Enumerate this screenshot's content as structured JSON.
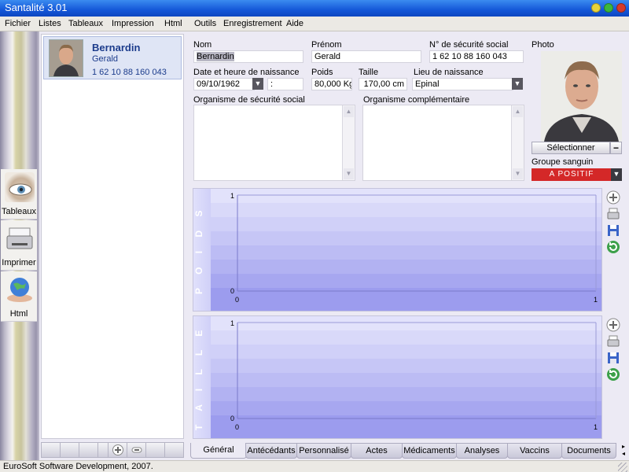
{
  "window": {
    "title": "Santalité 3.01"
  },
  "menu": [
    {
      "label": "Fichier"
    },
    {
      "label": "Listes"
    },
    {
      "label": "Tableaux"
    },
    {
      "label": "Impression"
    },
    {
      "label": "Html"
    },
    {
      "label": "Outils"
    },
    {
      "label": "Enregistrement"
    },
    {
      "label": "Aide"
    }
  ],
  "sidetools": {
    "tableaux": "Tableaux",
    "imprimer": "Imprimer",
    "html": "Html"
  },
  "patient_card": {
    "name": "Bernardin",
    "firstname": "Gerald",
    "ssn": "1 62 10 88 160 043"
  },
  "form": {
    "nom_label": "Nom",
    "nom_value": "Bernardin",
    "prenom_label": "Prénom",
    "prenom_value": "Gerald",
    "ssn_label": "N° de sécurité social",
    "ssn_value": "1 62 10 88 160 043",
    "photo_label": "Photo",
    "birth_label": "Date et heure de naissance",
    "birth_date": "09/10/1962",
    "birth_time": ":",
    "poids_label": "Poids",
    "poids_value": "80,000 Kg",
    "taille_label": "Taille",
    "taille_value": "170,00 cm",
    "lieu_label": "Lieu de naissance",
    "lieu_value": "Epinal",
    "org_secu_label": "Organisme de sécurité social",
    "org_comp_label": "Organisme complémentaire",
    "select_label": "Sélectionner",
    "remove_label": "−",
    "groupe_label": "Groupe sanguin",
    "groupe_value": "A POSITIF"
  },
  "charts_panel": [
    {
      "label": "P O I D S",
      "ymax": "1",
      "ymin": "0",
      "xmin": "0",
      "xmax": "1"
    },
    {
      "label": "T A I L L E",
      "ymax": "1",
      "ymin": "0",
      "xmin": "0",
      "xmax": "1"
    }
  ],
  "tabs": [
    {
      "label": "Général"
    },
    {
      "label": "Antécédants"
    },
    {
      "label": "Personnalisé"
    },
    {
      "label": "Actes"
    },
    {
      "label": "Médicaments"
    },
    {
      "label": "Analyses"
    },
    {
      "label": "Vaccins"
    },
    {
      "label": "Documents"
    }
  ],
  "status": {
    "text": "EuroSoft Software Development, 2007."
  },
  "colors": {
    "blood_group_bg": "#d42828",
    "title_bar": "#1457d8",
    "card_text": "#1c3c8c"
  },
  "icons": {
    "add": "plus-icon",
    "remove": "minus-icon",
    "print": "printer-icon",
    "save": "disk-icon",
    "refresh": "refresh-icon"
  }
}
